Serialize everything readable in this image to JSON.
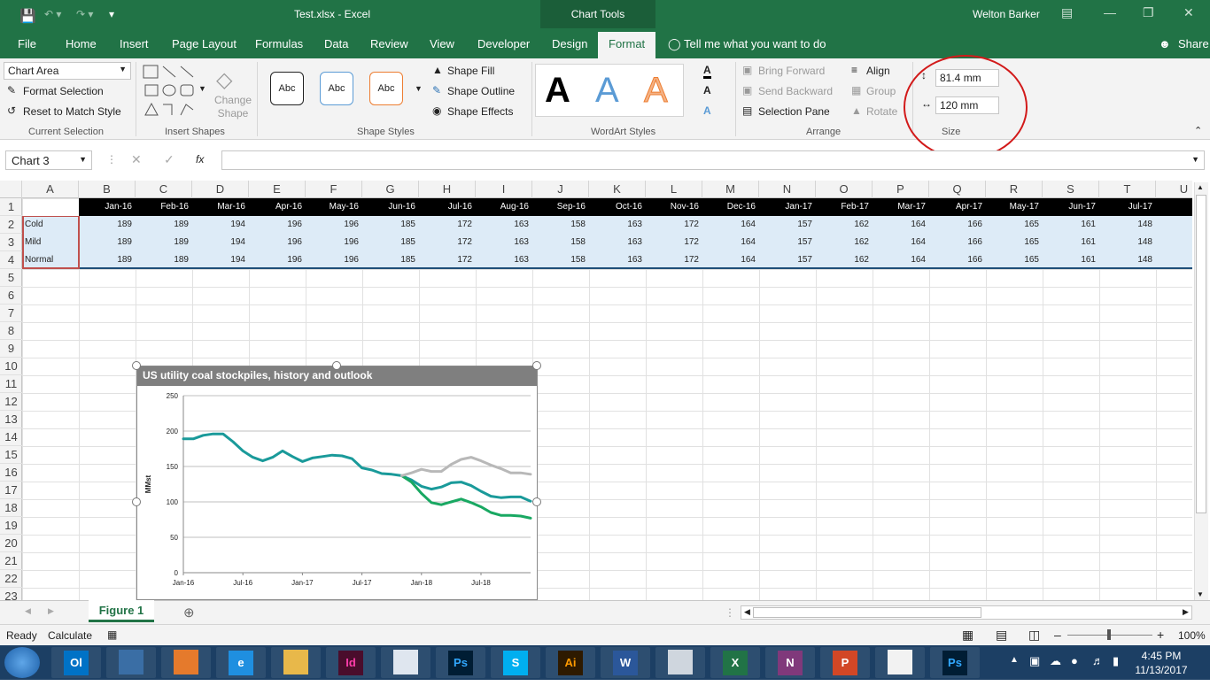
{
  "window": {
    "file_title": "Test.xlsx  -  Excel",
    "contextual_tab": "Chart Tools",
    "user": "Welton Barker"
  },
  "menu": {
    "tabs": [
      "File",
      "Home",
      "Insert",
      "Page Layout",
      "Formulas",
      "Data",
      "Review",
      "View",
      "Developer",
      "Design",
      "Format"
    ],
    "tell_me": "Tell me what you want to do",
    "share": "Share"
  },
  "ribbon": {
    "current_selection": {
      "dropdown_value": "Chart Area",
      "format_selection": "Format Selection",
      "reset": "Reset to Match Style",
      "label": "Current Selection"
    },
    "insert_shapes": {
      "change_shape": "Change Shape",
      "label": "Insert Shapes"
    },
    "shape_styles": {
      "samples": [
        "Abc",
        "Abc",
        "Abc"
      ],
      "fill": "Shape Fill",
      "outline": "Shape Outline",
      "effects": "Shape Effects",
      "label": "Shape Styles"
    },
    "wordart": {
      "samples": [
        "A",
        "A",
        "A"
      ],
      "label": "WordArt Styles"
    },
    "arrange": {
      "bring_forward": "Bring Forward",
      "send_backward": "Send Backward",
      "selection_pane": "Selection Pane",
      "align": "Align",
      "group": "Group",
      "rotate": "Rotate",
      "label": "Arrange"
    },
    "size": {
      "height": "81.4 mm",
      "width": "120 mm",
      "label": "Size"
    }
  },
  "formula_bar": {
    "name_box": "Chart 3",
    "fx": "fx",
    "content": ""
  },
  "sheet": {
    "columns": [
      "A",
      "B",
      "C",
      "D",
      "E",
      "F",
      "G",
      "H",
      "I",
      "J",
      "K",
      "L",
      "M",
      "N",
      "O",
      "P",
      "Q",
      "R",
      "S",
      "T",
      "U"
    ],
    "rows": [
      "1",
      "2",
      "3",
      "4",
      "5",
      "6",
      "7",
      "8",
      "9",
      "10",
      "11",
      "12",
      "13",
      "14",
      "15",
      "16",
      "17",
      "18",
      "19",
      "20",
      "21",
      "22",
      "23"
    ],
    "header_row": [
      "Jan-16",
      "Feb-16",
      "Mar-16",
      "Apr-16",
      "May-16",
      "Jun-16",
      "Jul-16",
      "Aug-16",
      "Sep-16",
      "Oct-16",
      "Nov-16",
      "Dec-16",
      "Jan-17",
      "Feb-17",
      "Mar-17",
      "Apr-17",
      "May-17",
      "Jun-17",
      "Jul-17",
      "Au"
    ],
    "data_rows": [
      {
        "label": "Cold",
        "values": [
          "189",
          "189",
          "194",
          "196",
          "196",
          "185",
          "172",
          "163",
          "158",
          "163",
          "172",
          "164",
          "157",
          "162",
          "164",
          "166",
          "165",
          "161",
          "148"
        ]
      },
      {
        "label": "Mild",
        "values": [
          "189",
          "189",
          "194",
          "196",
          "196",
          "185",
          "172",
          "163",
          "158",
          "163",
          "172",
          "164",
          "157",
          "162",
          "164",
          "166",
          "165",
          "161",
          "148"
        ]
      },
      {
        "label": "Normal",
        "values": [
          "189",
          "189",
          "194",
          "196",
          "196",
          "185",
          "172",
          "163",
          "158",
          "163",
          "172",
          "164",
          "157",
          "162",
          "164",
          "166",
          "165",
          "161",
          "148"
        ]
      }
    ]
  },
  "chart_data": {
    "type": "line",
    "title": "US utility coal stockpiles, history and outlook",
    "ylabel": "MMst",
    "xlabel": "",
    "ylim": [
      0,
      250
    ],
    "yticks": [
      "250",
      "200",
      "150",
      "100",
      "50",
      "0"
    ],
    "xtick_labels": [
      "Jan-16",
      "Jul-16",
      "Jan-17",
      "Jul-17",
      "Jan-18",
      "Jul-18"
    ],
    "grid": true,
    "colors": {
      "normal": "#1a9a9a",
      "cold": "#19a862",
      "mild": "#b8b8b8"
    },
    "series": [
      {
        "key": "normal",
        "values": [
          189,
          189,
          194,
          196,
          196,
          185,
          172,
          163,
          158,
          163,
          172,
          164,
          157,
          162,
          164,
          166,
          165,
          161,
          148,
          145,
          140,
          139,
          137,
          131,
          122,
          118,
          121,
          127,
          128,
          123,
          115,
          108,
          106,
          107,
          107,
          101
        ]
      },
      {
        "key": "cold",
        "values": [
          null,
          null,
          null,
          null,
          null,
          null,
          null,
          null,
          null,
          null,
          null,
          null,
          null,
          null,
          null,
          null,
          null,
          null,
          null,
          null,
          null,
          null,
          137,
          128,
          112,
          99,
          96,
          100,
          104,
          99,
          93,
          85,
          81,
          81,
          80,
          77
        ]
      },
      {
        "key": "mild",
        "values": [
          null,
          null,
          null,
          null,
          null,
          null,
          null,
          null,
          null,
          null,
          null,
          null,
          null,
          null,
          null,
          null,
          null,
          null,
          null,
          null,
          null,
          null,
          137,
          141,
          146,
          143,
          143,
          153,
          160,
          163,
          158,
          152,
          147,
          141,
          141,
          139,
          135
        ]
      }
    ]
  },
  "sheet_tabs": {
    "active": "Figure 1"
  },
  "status": {
    "ready": "Ready",
    "calculate": "Calculate",
    "zoom": "100%"
  },
  "taskbar": {
    "apps": [
      "Ol",
      "",
      "",
      "e",
      "",
      "Id",
      "",
      "Ps",
      "S",
      "Ai",
      "W",
      "",
      "X",
      "N",
      "P",
      "",
      "Ps"
    ],
    "time": "4:45 PM",
    "date": "11/13/2017"
  }
}
